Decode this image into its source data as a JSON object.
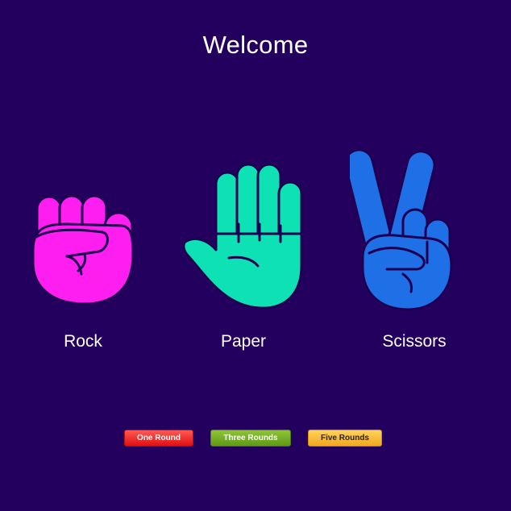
{
  "page": {
    "title": "Welcome"
  },
  "choices": [
    {
      "label": "Rock",
      "icon": "rock-fist-icon",
      "color": "#ff1ef0"
    },
    {
      "label": "Paper",
      "icon": "paper-hand-icon",
      "color": "#0ee2b4"
    },
    {
      "label": "Scissors",
      "icon": "scissors-peace-icon",
      "color": "#1f6fe6"
    }
  ],
  "rounds": {
    "one": {
      "label": "One Round",
      "color": "#e81818"
    },
    "three": {
      "label": "Three Rounds",
      "color": "#6aa51e"
    },
    "five": {
      "label": "Five Rounds",
      "color": "#f5b833"
    }
  },
  "theme": {
    "background": "#23005e",
    "outline": "#1e0053"
  }
}
